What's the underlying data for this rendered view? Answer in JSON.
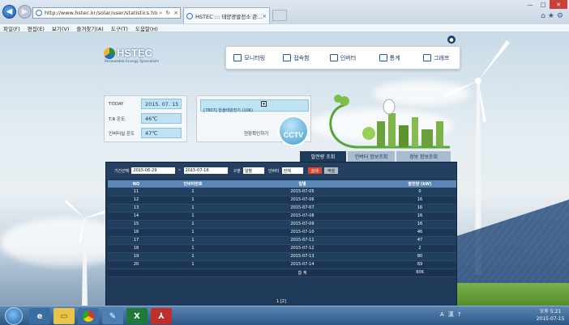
{
  "browser": {
    "url": "http://www.hstec.kr/solar/user/statistics.html?mcnoV",
    "tab_title": "HSTEC ::: 태양광발전소 관...",
    "menu": [
      "파일(F)",
      "편집(E)",
      "보기(V)",
      "즐겨찾기(A)",
      "도구(T)",
      "도움말(H)"
    ]
  },
  "logo": {
    "name": "HSTEC",
    "tagline": "Renewable Energy Specialists"
  },
  "nav": [
    "모니터링",
    "접속함",
    "인버터",
    "통계",
    "그래프"
  ],
  "info": {
    "today_label": "TODAY",
    "today_value": "2015. 07. 15",
    "tr_temp_label": "T.R 온도",
    "tr_temp_value": "46℃",
    "inv_temp_label": "인버터실 온도",
    "inv_temp_value": "47℃"
  },
  "cctv": {
    "selected": "[7807] 한솔태양전기 (10K)",
    "link": "현장확인하기",
    "badge": "CCTV"
  },
  "tabs": [
    "발전량 조회",
    "인버터 정보조회",
    "경보 정보조회"
  ],
  "filter": {
    "period_label": "기간선택",
    "start_date": "2015-06-29",
    "separator": "~",
    "end_date": "2015-07-16",
    "unit_label": "구분",
    "unit_value": "일별",
    "inverter_label": "인버터",
    "inverter_value": "전체",
    "search_button": "검색",
    "excel_button": "엑셀"
  },
  "table": {
    "headers": [
      "NO",
      "인버터번호",
      "일별",
      "발전량 (kW)"
    ],
    "rows": [
      [
        "11",
        "1",
        "2015-07-05",
        "0"
      ],
      [
        "12",
        "1",
        "2015-07-06",
        "16"
      ],
      [
        "13",
        "1",
        "2015-07-07",
        "16"
      ],
      [
        "14",
        "1",
        "2015-07-08",
        "16"
      ],
      [
        "15",
        "1",
        "2015-07-09",
        "16"
      ],
      [
        "16",
        "1",
        "2015-07-10",
        "46"
      ],
      [
        "17",
        "1",
        "2015-07-11",
        "47"
      ],
      [
        "18",
        "1",
        "2015-07-12",
        "2"
      ],
      [
        "19",
        "1",
        "2015-07-13",
        "80"
      ],
      [
        "20",
        "1",
        "2015-07-14",
        "69"
      ]
    ],
    "total_label": "합 계",
    "total_value": "606"
  },
  "pager": "1 [2]",
  "taskbar": {
    "tray_items": [
      "A",
      "漢",
      "?"
    ],
    "time": "오후 5:21",
    "date": "2015-07-15"
  },
  "colors": {
    "panel_bg": "#1f3a59",
    "header_bg": "#5a86b8",
    "search_btn": "#e0462c",
    "value_box": "#bfe3f2"
  }
}
